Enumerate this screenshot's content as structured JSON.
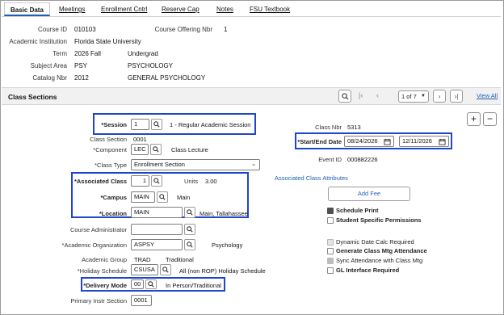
{
  "tabs": [
    {
      "label": "Basic Data"
    },
    {
      "label": "Meetings"
    },
    {
      "label": "Enrollment Cntrl"
    },
    {
      "label": "Reserve Cap"
    },
    {
      "label": "Notes"
    },
    {
      "label": "FSU Textbook"
    }
  ],
  "header": {
    "course_id_label": "Course ID",
    "course_id": "010103",
    "offering_label": "Course Offering Nbr",
    "offering": "1",
    "institution_label": "Academic Institution",
    "institution": "Florida State University",
    "term_label": "Term",
    "term": "2026 Fall",
    "career": "Undergrad",
    "subject_label": "Subject Area",
    "subject": "PSY",
    "subject_desc": "PSYCHOLOGY",
    "catalog_label": "Catalog Nbr",
    "catalog": "2012",
    "catalog_desc": "GENERAL PSYCHOLOGY"
  },
  "section_bar": {
    "title": "Class Sections",
    "pager_value": "1 of 7",
    "view_all": "View All"
  },
  "form": {
    "session_label": "*Session",
    "session_value": "1",
    "session_desc": "1 - Regular Academic Session",
    "class_section_label": "Class Section",
    "class_section": "0001",
    "component_label": "*Component",
    "component_value": "LEC",
    "component_desc": "Class Lecture",
    "class_type_label": "*Class Type",
    "class_type_value": "Enrollment Section",
    "assoc_class_label": "*Associated Class",
    "assoc_class_value": "1",
    "units_label": "Units",
    "units_value": "3.00",
    "campus_label": "*Campus",
    "campus_value": "MAIN",
    "campus_desc": "Main",
    "location_label": "*Location",
    "location_value": "MAIN",
    "location_desc": "Main, Tallahassee",
    "course_admin_label": "Course Administrator",
    "course_admin_value": "",
    "acad_org_label": "*Academic Organization",
    "acad_org_value": "ASPSY",
    "acad_org_desc": "Psychology",
    "acad_group_label": "Academic Group",
    "acad_group_value": "TRAD",
    "acad_group_desc": "Traditional",
    "holiday_label": "*Holiday Schedule",
    "holiday_value": "CSUSA",
    "holiday_desc": "All (non ROP) Holiday Schedule",
    "delivery_label": "*Delivery Mode",
    "delivery_value": "00",
    "delivery_desc": "In Person/Traditional",
    "primary_instr_label": "Primary Instr Section",
    "primary_instr_value": "0001"
  },
  "right_panel": {
    "class_nbr_label": "Class Nbr",
    "class_nbr": "5313",
    "dates_label": "*Start/End Date",
    "start_date": "08/24/2026",
    "end_date": "12/11/2026",
    "event_id_label": "Event ID",
    "event_id": "000882226",
    "assoc_attr_link": "Associated Class Attributes",
    "add_fee_button": "Add Fee",
    "checkboxes": [
      {
        "label": "Schedule Print",
        "state": "checked"
      },
      {
        "label": "Student Specific Permissions",
        "state": "unchecked"
      },
      {
        "label": "Dynamic Date Calc Required",
        "state": "disabled"
      },
      {
        "label": "Generate Class Mtg Attendance",
        "state": "unchecked"
      },
      {
        "label": "Sync Attendance with Class Mtg",
        "state": "checked-disabled"
      },
      {
        "label": "GL Interface Required",
        "state": "unchecked"
      }
    ],
    "add_row": "+",
    "delete_row": "−"
  },
  "colors": {
    "highlight": "#1f46c8",
    "link": "#1f5fb8",
    "tab_underline": "#1e5eb8"
  }
}
